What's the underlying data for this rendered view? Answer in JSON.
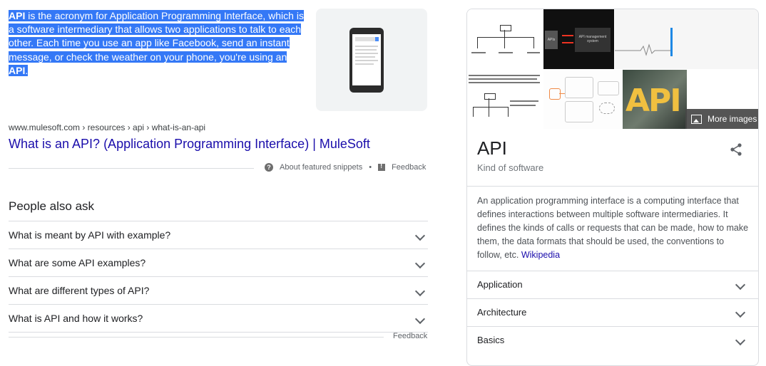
{
  "snippet": {
    "t1": "API",
    "t2": " is the acronym for Application Programming Interface, which is a software intermediary that allows two applications to talk to each other. Each time you use an app like Facebook, send an instant message, or check the weather on your phone, you're using an ",
    "t3": "API",
    "t4": "."
  },
  "thumbnail": {
    "icon": "phone-icon"
  },
  "result": {
    "cite": "www.mulesoft.com › resources › api › what-is-an-api",
    "title": "What is an API? (Application Programming Interface) | MuleSoft"
  },
  "snippet_footer": {
    "about": "About featured snippets",
    "separator": "•",
    "feedback": "Feedback"
  },
  "paa": {
    "title": "People also ask",
    "questions": [
      "What is meant by API with example?",
      "What are some API examples?",
      "What are different types of API?",
      "What is API and how it works?"
    ],
    "feedback": "Feedback"
  },
  "knowledge_panel": {
    "more_images": "More images",
    "title": "API",
    "subtitle": "Kind of software",
    "description": "An application programming interface is a computing interface that defines interactions between multiple software intermediaries. It defines the kinds of calls or requests that can be made, how to make them, the data formats that should be used, the conventions to follow, etc. ",
    "source_link": "Wikipedia",
    "rows": [
      "Application",
      "Architecture",
      "Basics"
    ],
    "image_text": {
      "apis": "APIs",
      "api_management": "API management system",
      "api_letters": "API"
    }
  },
  "colors": {
    "selection": "#3478f6",
    "link": "#1a0dab",
    "text": "#202124",
    "divider": "#dadce0"
  }
}
